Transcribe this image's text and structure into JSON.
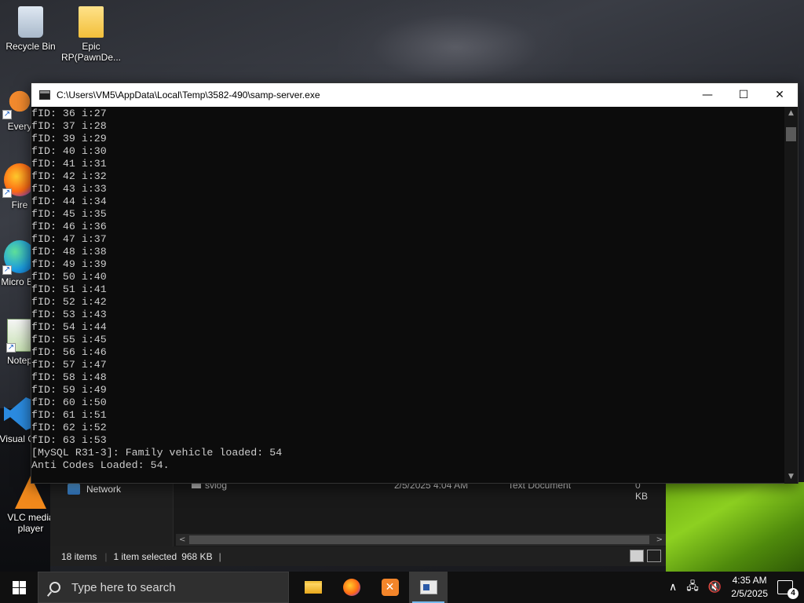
{
  "desktop": {
    "icons": [
      {
        "label": "Recycle Bin",
        "icon": "recycle-bin-icon"
      },
      {
        "label": "Epic RP(PawnDe...",
        "icon": "folder-icon"
      },
      {
        "label": "Every",
        "icon": "everything-icon"
      },
      {
        "label": "Fire",
        "icon": "firefox-icon"
      },
      {
        "label": "Micro Ed",
        "icon": "edge-icon"
      },
      {
        "label": "Notep",
        "icon": "notepad-plus-icon"
      },
      {
        "label": "Visual Co",
        "icon": "vscode-icon"
      },
      {
        "label": "VLC media player",
        "icon": "vlc-icon"
      }
    ]
  },
  "console": {
    "title": "C:\\Users\\VM5\\AppData\\Local\\Temp\\3582-490\\samp-server.exe",
    "lines": [
      "fID: 36 i:27",
      "fID: 37 i:28",
      "fID: 39 i:29",
      "fID: 40 i:30",
      "fID: 41 i:31",
      "fID: 42 i:32",
      "fID: 43 i:33",
      "fID: 44 i:34",
      "fID: 45 i:35",
      "fID: 46 i:36",
      "fID: 47 i:37",
      "fID: 48 i:38",
      "fID: 49 i:39",
      "fID: 50 i:40",
      "fID: 51 i:41",
      "fID: 52 i:42",
      "fID: 53 i:43",
      "fID: 54 i:44",
      "fID: 55 i:45",
      "fID: 56 i:46",
      "fID: 57 i:47",
      "fID: 58 i:48",
      "fID: 59 i:49",
      "fID: 60 i:50",
      "fID: 61 i:51",
      "fID: 62 i:52",
      "fID: 63 i:53",
      "[MySQL R31-3]: Family vehicle loaded: 54",
      "Anti Codes Loaded: 54."
    ],
    "text_color": "#cccccc",
    "background": "#0c0c0c"
  },
  "explorer": {
    "nav_item": "Network",
    "file": {
      "name": "svlog",
      "date": "2/5/2025 4:04 AM",
      "type": "Text Document",
      "size": "0 KB"
    },
    "status": {
      "items": "18 items",
      "selected": "1 item selected",
      "size": "968 KB"
    }
  },
  "taskbar": {
    "search_placeholder": "Type here to search",
    "apps": [
      "file-explorer-icon",
      "firefox-icon",
      "xampp-icon",
      "console-icon"
    ],
    "time": "4:35 AM",
    "date": "2/5/2025",
    "notification_count": "4"
  }
}
